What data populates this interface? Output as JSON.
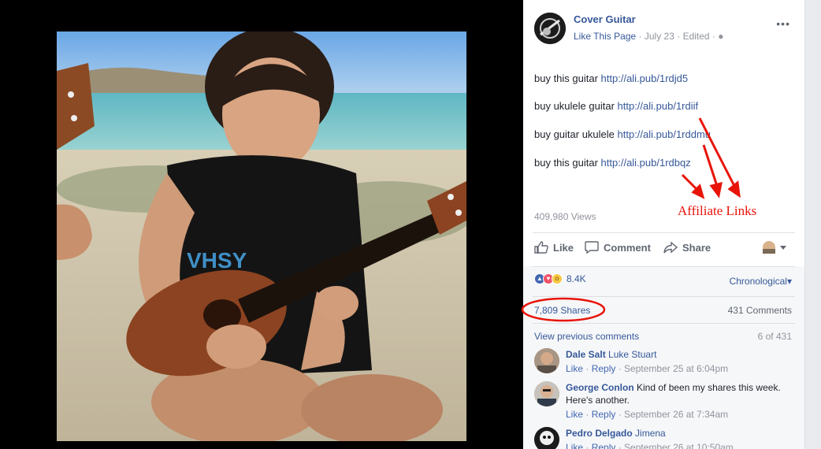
{
  "post": {
    "page_name": "Cover Guitar",
    "like_page": "Like This Page",
    "date": "July 23",
    "edited": "Edited",
    "more_icon": "ellipsis-icon",
    "lines": [
      {
        "text": "buy this guitar ",
        "link": "http://ali.pub/1rdjd5"
      },
      {
        "text": "buy ukulele guitar ",
        "link": "http://ali.pub/1rdiif"
      },
      {
        "text": "buy guitar ukulele ",
        "link": "http://ali.pub/1rddmu"
      },
      {
        "text": "buy this guitar ",
        "link": "http://ali.pub/1rdbqz"
      }
    ],
    "views": "409,980 Views"
  },
  "actions": {
    "like": "Like",
    "comment": "Comment",
    "share": "Share"
  },
  "stats": {
    "reaction_count": "8.4K",
    "chronological": "Chronological",
    "shares": "7,809 Shares",
    "comments": "431 Comments",
    "view_previous": "View previous comments",
    "of_count": "6 of 431"
  },
  "comments": [
    {
      "name": "Dale Salt",
      "tag": "Luke Stuart",
      "text": "",
      "like": "Like",
      "reply": "Reply",
      "time": "September 25 at 6:04pm"
    },
    {
      "name": "George Conlon",
      "tag": "",
      "text": "Kind of been my shares this week. Here's another.",
      "like": "Like",
      "reply": "Reply",
      "time": "September 26 at 7:34am"
    },
    {
      "name": "Pedro Delgado",
      "tag": "Jimena",
      "text": "",
      "like": "Like",
      "reply": "Reply",
      "time": "September 26 at 10:50am"
    }
  ],
  "annotation": {
    "label": "Affiliate Links",
    "color": "#e8140a"
  },
  "colors": {
    "link": "#365899",
    "meta": "#90949c",
    "strip": "#f6f7f9"
  }
}
